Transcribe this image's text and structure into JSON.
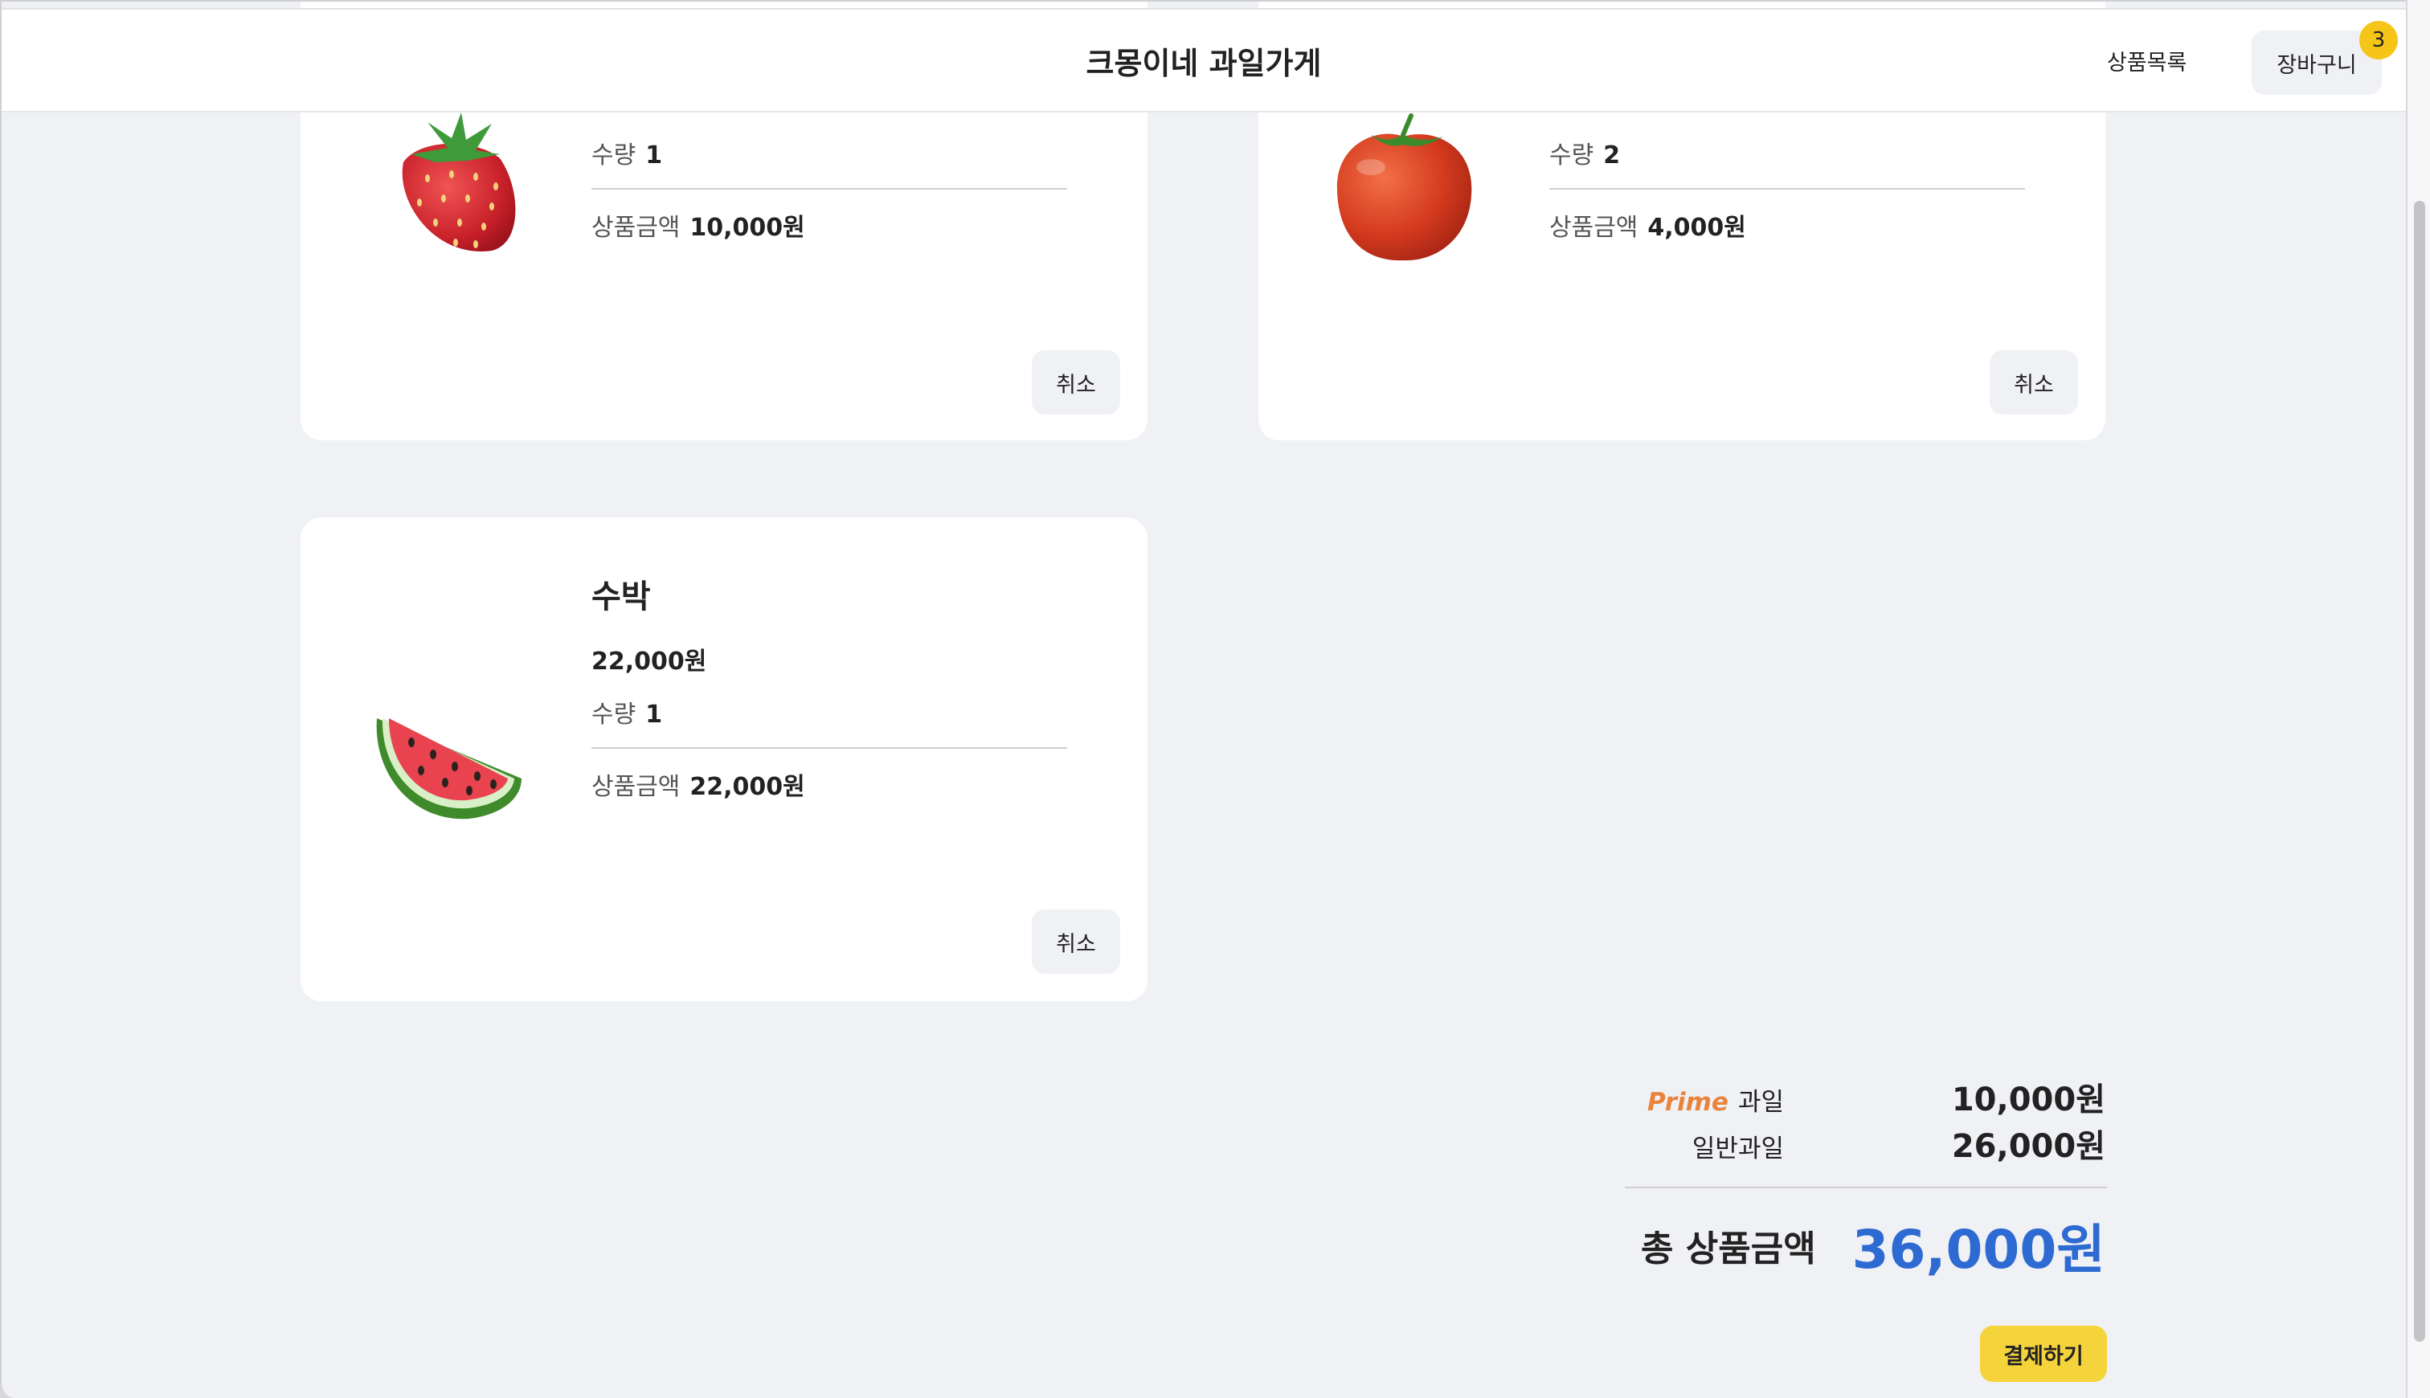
{
  "header": {
    "title": "크몽이네 과일가게",
    "nav_products": "상품목록",
    "cart_label": "장바구니",
    "cart_count": "3"
  },
  "cart": {
    "items": [
      {
        "fruit": "strawberry",
        "name": "",
        "price": "",
        "qty_label": "수량",
        "qty": "1",
        "total_label": "상품금액",
        "total": "10,000원",
        "cancel_label": "취소"
      },
      {
        "fruit": "tomato",
        "name": "",
        "price": "",
        "qty_label": "수량",
        "qty": "2",
        "total_label": "상품금액",
        "total": "4,000원",
        "cancel_label": "취소"
      },
      {
        "fruit": "watermelon",
        "name": "수박",
        "price": "22,000원",
        "qty_label": "수량",
        "qty": "1",
        "total_label": "상품금액",
        "total": "22,000원",
        "cancel_label": "취소"
      }
    ]
  },
  "summary": {
    "prime_tag": "Prime",
    "prime_label": "과일",
    "prime_value": "10,000원",
    "normal_label": "일반과일",
    "normal_value": "26,000원",
    "total_label": "총 상품금액",
    "total_value": "36,000원",
    "checkout_label": "결제하기"
  },
  "colors": {
    "accent_blue": "#2d6ad2",
    "badge_yellow": "#f5c518",
    "checkout_yellow": "#f5d33a",
    "prime_orange": "#e8843c",
    "background": "#f0f1f5"
  }
}
